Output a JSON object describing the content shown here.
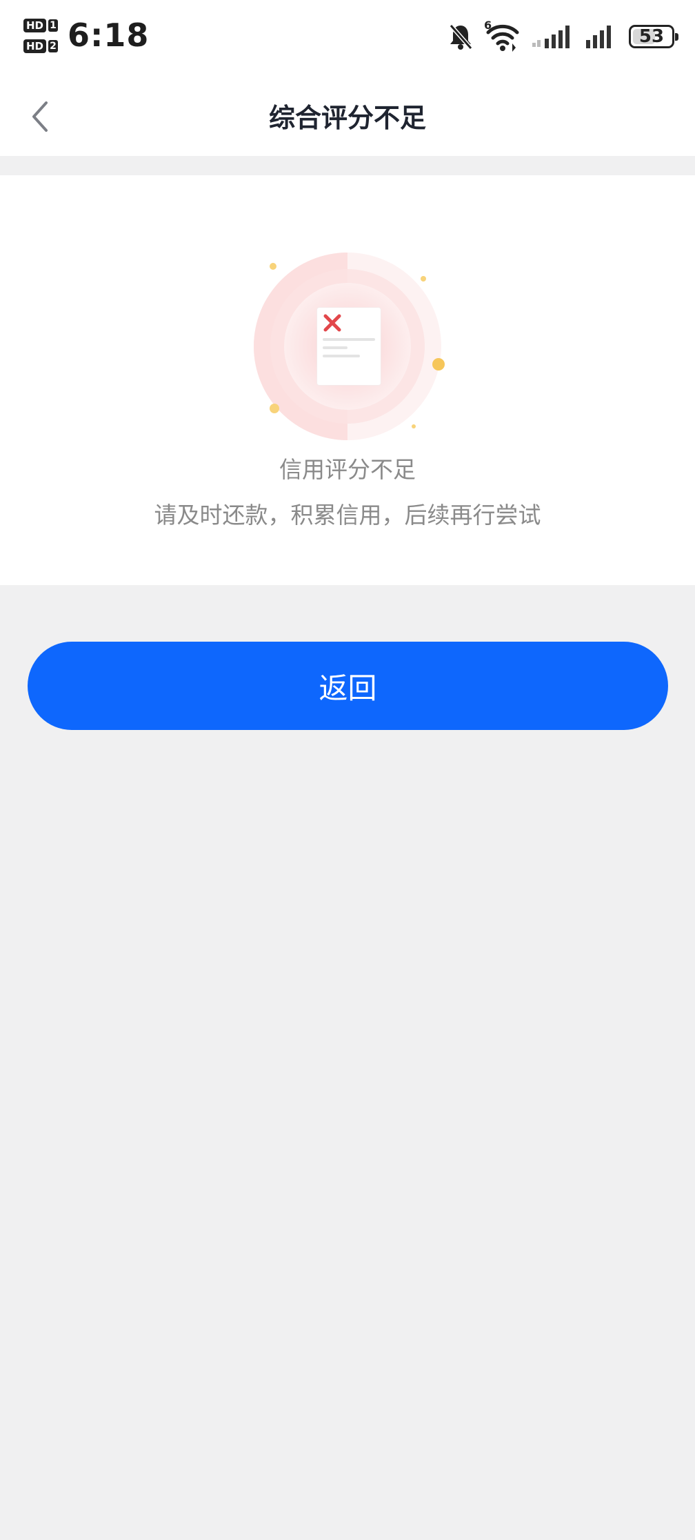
{
  "status_bar": {
    "sim1_label": "HD",
    "sim1_num": "1",
    "sim2_label": "HD",
    "sim2_num": "2",
    "time": "6:18",
    "wifi_badge": "6",
    "battery_level": "53",
    "icons": [
      "bell-muted-icon",
      "wifi-icon",
      "signal-icon",
      "signal-icon",
      "battery-icon"
    ]
  },
  "navbar": {
    "title": "综合评分不足",
    "back_icon": "chevron-left-icon"
  },
  "result": {
    "illustration_icon": "rejected-document-icon",
    "title": "信用评分不足",
    "description": "请及时还款，积累信用，后续再行尝试"
  },
  "actions": {
    "return_label": "返回"
  },
  "colors": {
    "primary": "#0e67fd",
    "background": "#f0f0f1",
    "muted_text": "#8a8a8a",
    "title_text": "#1f2430",
    "error_red": "#e2474b"
  }
}
